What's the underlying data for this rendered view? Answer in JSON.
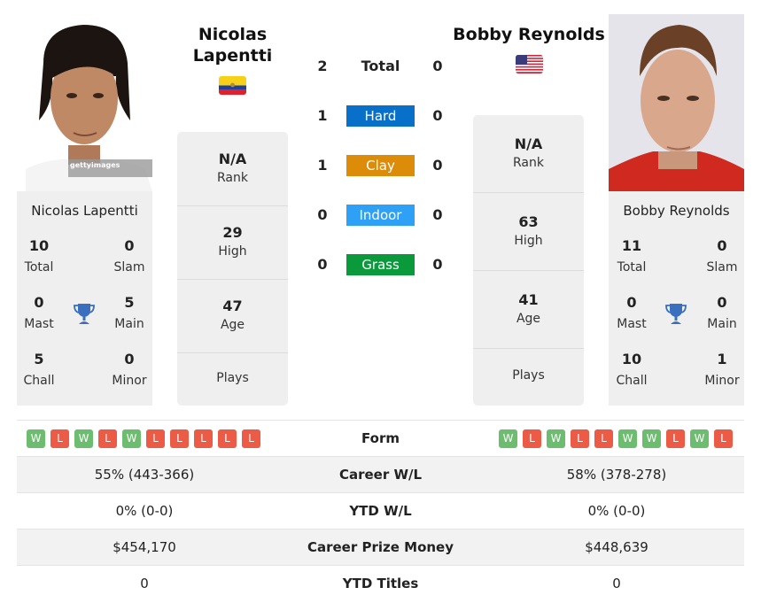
{
  "player_left": {
    "name": "Nicolas Lapentti",
    "heading_line1": "Nicolas",
    "heading_line2": "Lapentti",
    "flag": "ecuador-flag",
    "photo_caption": "gettyimages",
    "titles": {
      "total": "10",
      "total_label": "Total",
      "slam": "0",
      "slam_label": "Slam",
      "mast": "0",
      "mast_label": "Mast",
      "main": "5",
      "main_label": "Main",
      "chall": "5",
      "chall_label": "Chall",
      "minor": "0",
      "minor_label": "Minor"
    },
    "rank": "N/A",
    "rank_label": "Rank",
    "high": "29",
    "high_label": "High",
    "age": "47",
    "age_label": "Age",
    "plays_label": "Plays"
  },
  "player_right": {
    "name": "Bobby Reynolds",
    "heading": "Bobby Reynolds",
    "flag": "usa-flag",
    "titles": {
      "total": "11",
      "total_label": "Total",
      "slam": "0",
      "slam_label": "Slam",
      "mast": "0",
      "mast_label": "Mast",
      "main": "0",
      "main_label": "Main",
      "chall": "10",
      "chall_label": "Chall",
      "minor": "1",
      "minor_label": "Minor"
    },
    "rank": "N/A",
    "rank_label": "Rank",
    "high": "63",
    "high_label": "High",
    "age": "41",
    "age_label": "Age",
    "plays_label": "Plays"
  },
  "h2h": [
    {
      "surface": "Total",
      "left": "2",
      "right": "0",
      "color": null
    },
    {
      "surface": "Hard",
      "left": "1",
      "right": "0",
      "color": "#0870c8"
    },
    {
      "surface": "Clay",
      "left": "1",
      "right": "0",
      "color": "#dc8c08"
    },
    {
      "surface": "Indoor",
      "left": "0",
      "right": "0",
      "color": "#2ea0f5"
    },
    {
      "surface": "Grass",
      "left": "0",
      "right": "0",
      "color": "#0a9a3c"
    }
  ],
  "table": {
    "form_label": "Form",
    "form_left": [
      "W",
      "L",
      "W",
      "L",
      "W",
      "L",
      "L",
      "L",
      "L",
      "L"
    ],
    "form_right": [
      "W",
      "L",
      "W",
      "L",
      "L",
      "W",
      "W",
      "L",
      "W",
      "L"
    ],
    "rows": [
      {
        "label": "Career W/L",
        "left": "55% (443-366)",
        "right": "58% (378-278)"
      },
      {
        "label": "YTD W/L",
        "left": "0% (0-0)",
        "right": "0% (0-0)"
      },
      {
        "label": "Career Prize Money",
        "left": "$454,170",
        "right": "$448,639"
      },
      {
        "label": "YTD Titles",
        "left": "0",
        "right": "0"
      }
    ]
  }
}
